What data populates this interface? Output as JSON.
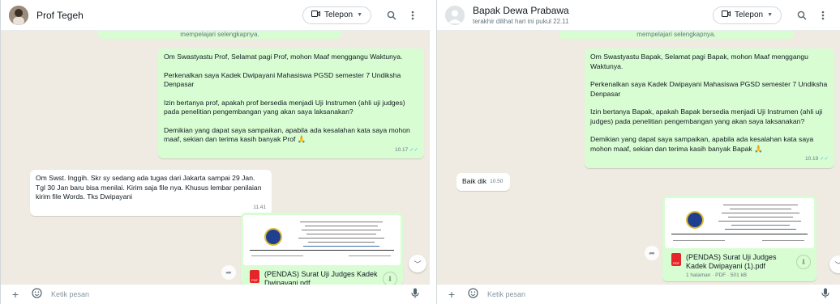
{
  "panels": [
    {
      "contact_name": "Prof Tegeh",
      "status": "",
      "call_label": "Telepon",
      "top_cut_text": "mempelajari selengkapnya.",
      "out_message": {
        "paragraphs": [
          "Om Swastyastu Prof, Selamat pagi Prof, mohon Maaf menggangu Waktunya.",
          "Perkenalkan saya Kadek Dwipayani Mahasiswa PGSD semester 7 Undiksha Denpasar",
          "Izin bertanya prof, apakah prof bersedia menjadi Uji Instrumen (ahli uji judges) pada penelitian pengembangan yang akan saya laksanakan?",
          "Demikian yang dapat saya sampaikan, apabila ada kesalahan kata saya mohon maaf, sekian dan terima kasih banyak Prof 🙏"
        ],
        "time": "10.17"
      },
      "in_message": {
        "text": "Om Swst. Inggih. Skr sy sedang ada tugas dari Jakarta sampai 29 Jan. Tgl 30 Jan baru bisa menilai. Kirim saja file nya. Khusus lembar penilaian kirim file Words. Tks Dwipayani",
        "time": "11.41"
      },
      "document": {
        "name": "(PENDAS) Surat Uji Judges Kadek Dwipayani.pdf",
        "meta": ""
      },
      "input_placeholder": "Ketik pesan"
    },
    {
      "contact_name": "Bapak Dewa Prabawa",
      "status": "terakhir dilihat hari ini pukul 22.11",
      "call_label": "Telepon",
      "top_cut_text": "mempelajari selengkapnya.",
      "out_message": {
        "paragraphs": [
          "Om Swastyastu Bapak, Selamat pagi Bapak, mohon Maaf menggangu Waktunya.",
          "Perkenalkan saya Kadek Dwipayani Mahasiswa PGSD semester 7 Undiksha Denpasar",
          "Izin bertanya Bapak, apakah Bapak bersedia menjadi Uji Instrumen (ahli uji judges) pada penelitian pengembangan yang akan saya laksanakan?",
          "Demikian yang dapat saya sampaikan, apabila ada kesalahan kata saya mohon maaf, sekian dan terima kasih banyak Bapak 🙏"
        ],
        "time": "10.19"
      },
      "in_message": {
        "text": "Baik dik",
        "time": "10.50"
      },
      "document": {
        "name": "(PENDAS) Surat Uji Judges Kadek Dwipayani (1).pdf",
        "meta": "1 halaman · PDF · 501 kB"
      },
      "input_placeholder": "Ketik pesan"
    }
  ],
  "icons": {
    "video": "video-icon",
    "search": "search-icon",
    "menu": "menu-icon",
    "add": "plus-icon",
    "emoji": "emoji-icon",
    "mic": "mic-icon",
    "download": "download-icon",
    "forward": "forward-icon",
    "scroll": "chevron-down-icon"
  },
  "colors": {
    "outgoing_bubble": "#d9fdd3",
    "incoming_bubble": "#ffffff",
    "chat_background": "#efeae2",
    "read_tick": "#53bdeb"
  }
}
